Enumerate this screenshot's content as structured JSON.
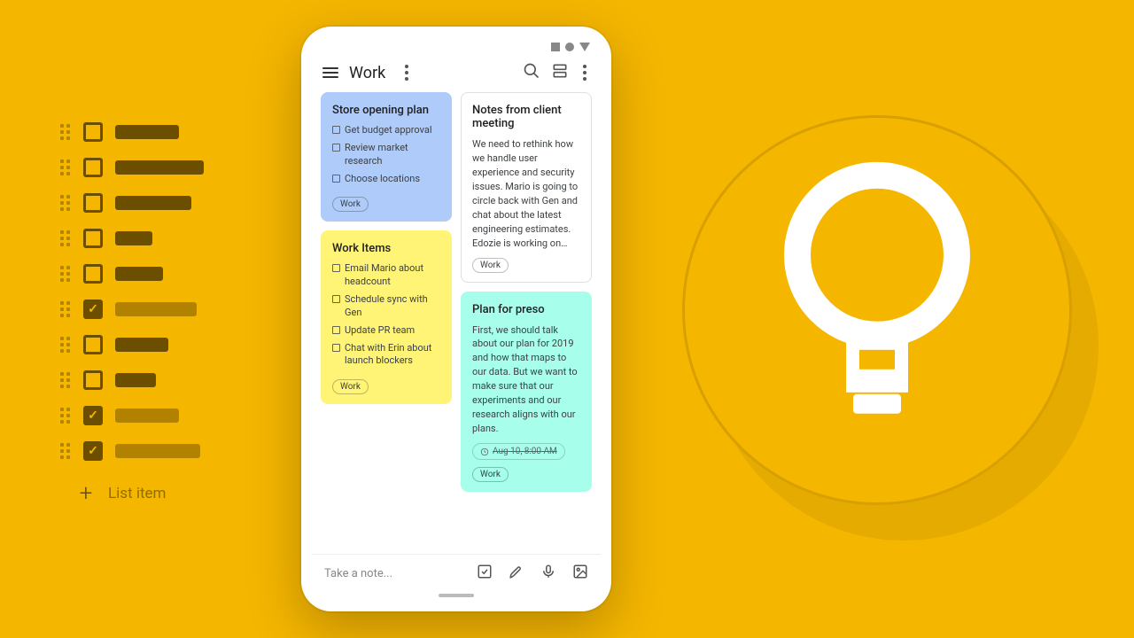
{
  "left_panel": {
    "add_label": "List item"
  },
  "phone": {
    "header": {
      "title": "Work"
    },
    "notes": {
      "store_plan": {
        "title": "Store opening plan",
        "items": [
          "Get budget approval",
          "Review market research",
          "Choose locations"
        ],
        "tag": "Work"
      },
      "work_items": {
        "title": "Work Items",
        "items": [
          "Email Mario about headcount",
          "Schedule sync with Gen",
          "Update PR team",
          "Chat with Erin about launch blockers"
        ],
        "tag": "Work"
      },
      "client_notes": {
        "title": "Notes from client meeting",
        "body": "We need to rethink how we handle user experience and security issues. Mario is going to circle back with Gen and chat about the latest engineering estimates. Edozie is working on…",
        "tag": "Work"
      },
      "preso": {
        "title": "Plan for preso",
        "body": "First, we should talk about our plan for 2019 and how that maps to our data. But we want to make sure that our experiments and our research aligns with our plans.",
        "reminder": "Aug 10, 8:00 AM",
        "tag": "Work"
      }
    },
    "bottom": {
      "placeholder": "Take a note..."
    }
  }
}
